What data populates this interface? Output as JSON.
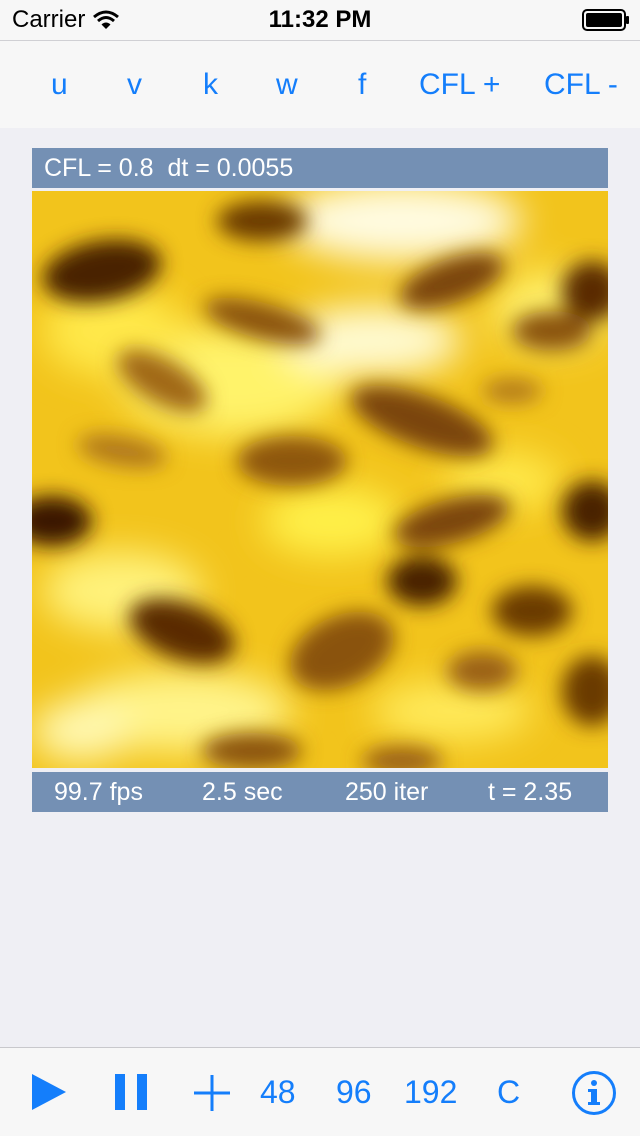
{
  "status_bar": {
    "carrier": "Carrier",
    "time": "11:32 PM"
  },
  "top_toolbar": {
    "buttons": [
      "u",
      "v",
      "k",
      "w",
      "f",
      "CFL +",
      "CFL -"
    ]
  },
  "sim_header": {
    "text": "CFL = 0.8  dt = 0.0055"
  },
  "sim_stats": {
    "fps": "99.7 fps",
    "seconds": "2.5 sec",
    "iterations": "250 iter",
    "time": "t = 2.35"
  },
  "bottom_toolbar": {
    "play_icon": "play-icon",
    "pause_icon": "pause-icon",
    "add_icon": "plus-icon",
    "grid_48": "48",
    "grid_96": "96",
    "grid_192": "192",
    "clear": "C",
    "info_icon": "info-icon"
  },
  "colors": {
    "accent": "#147efb",
    "info_bar": "#7490b4",
    "background": "#efeff4"
  }
}
